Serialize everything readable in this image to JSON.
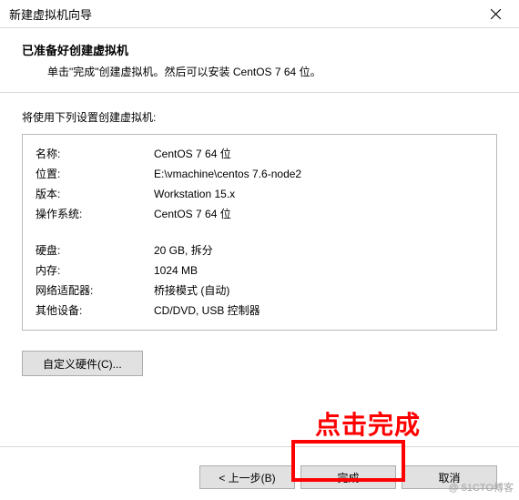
{
  "window": {
    "title": "新建虚拟机向导"
  },
  "header": {
    "title": "已准备好创建虚拟机",
    "subtitle": "单击\"完成\"创建虚拟机。然后可以安装 CentOS 7 64 位。"
  },
  "content": {
    "lead": "将使用下列设置创建虚拟机:",
    "rows1": [
      {
        "k": "名称:",
        "v": "CentOS 7 64 位"
      },
      {
        "k": "位置:",
        "v": "E:\\vmachine\\centos 7.6-node2"
      },
      {
        "k": "版本:",
        "v": "Workstation 15.x"
      },
      {
        "k": "操作系统:",
        "v": "CentOS 7 64 位"
      }
    ],
    "rows2": [
      {
        "k": "硬盘:",
        "v": "20 GB, 拆分"
      },
      {
        "k": "内存:",
        "v": "1024 MB"
      },
      {
        "k": "网络适配器:",
        "v": "桥接模式 (自动)"
      },
      {
        "k": "其他设备:",
        "v": "CD/DVD, USB 控制器"
      }
    ],
    "customize_label": "自定义硬件(C)..."
  },
  "annotation": {
    "text": "点击完成"
  },
  "footer": {
    "back": "< 上一步(B)",
    "finish": "完成",
    "cancel": "取消"
  },
  "watermark": "@ 51CTO博客"
}
